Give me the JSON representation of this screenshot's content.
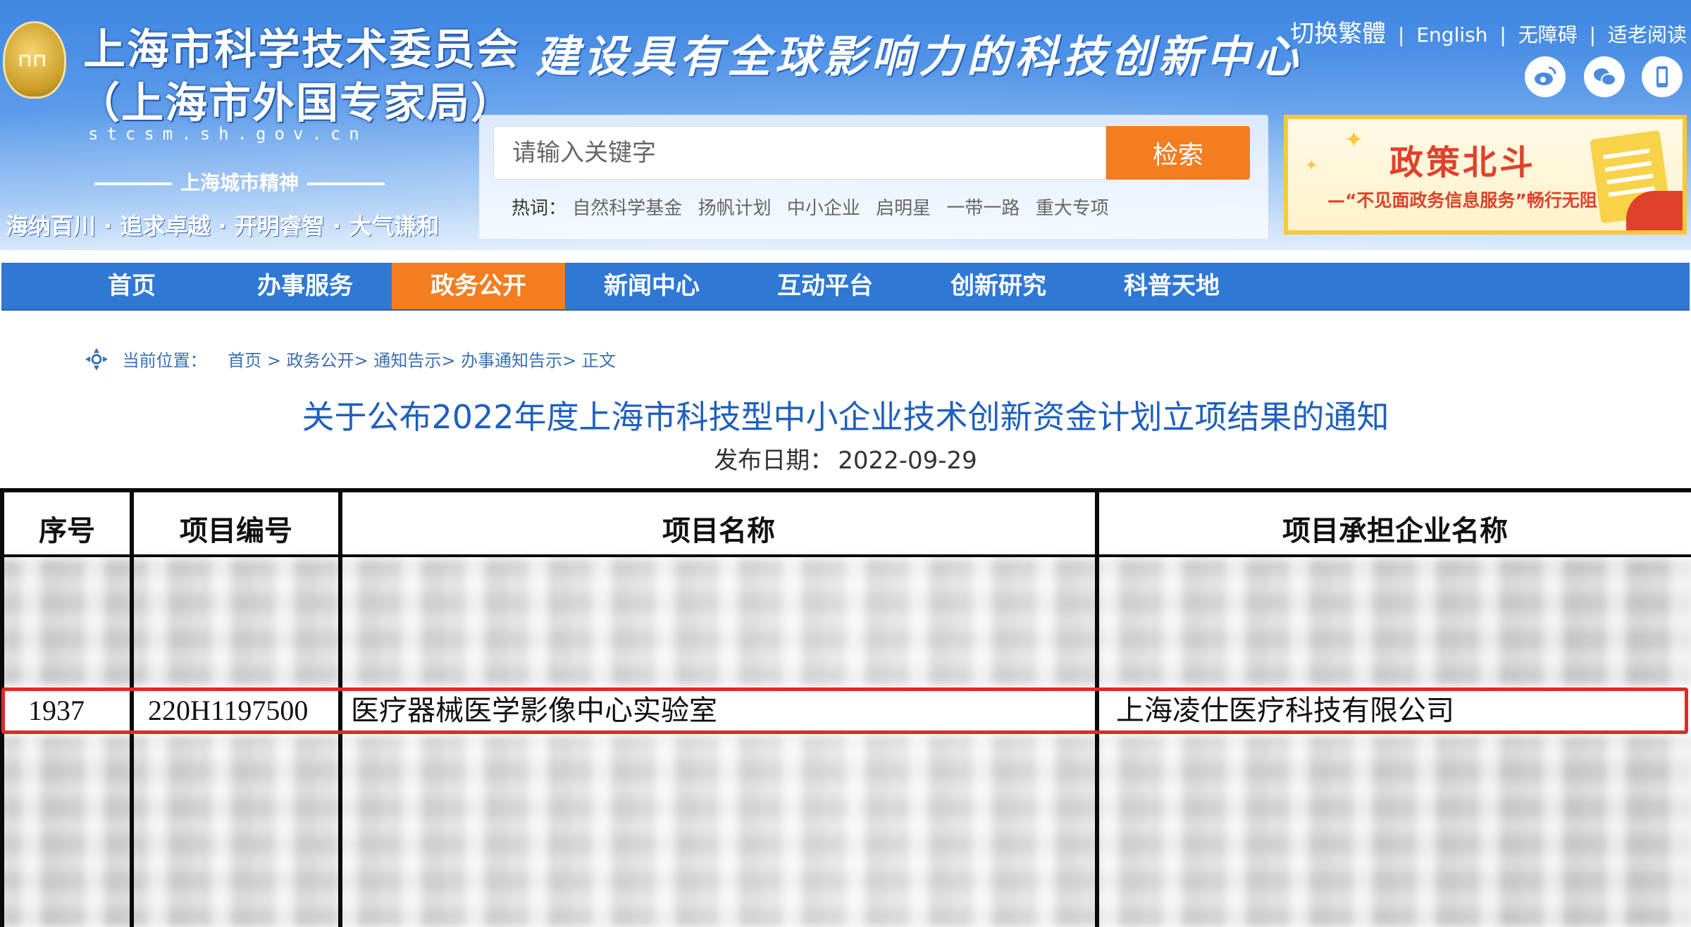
{
  "header": {
    "org_name": "上海市科学技术委员会",
    "org_sub": "（上海市外国专家局）",
    "domain": "stcsm.sh.gov.cn",
    "spirit_title": "上海城市精神",
    "spirit_motto": "海纳百川 · 追求卓越 · 开明睿智 · 大气谦和",
    "slogan": "建设具有全球影响力的科技创新中心",
    "top_links": [
      "切换繁體",
      "English",
      "无障碍",
      "适老阅读"
    ],
    "social_icons": [
      "weibo-icon",
      "wechat-icon",
      "mobile-icon"
    ]
  },
  "search": {
    "placeholder": "请输入关键字",
    "button": "检索",
    "hot_label": "热词：",
    "hot_words": [
      "自然科学基金",
      "扬帆计划",
      "中小企业",
      "启明星",
      "一带一路",
      "重大专项"
    ]
  },
  "banner": {
    "title": "政策北斗",
    "subtitle": "—“不见面政务信息服务”畅行无阻"
  },
  "nav": {
    "items": [
      "首页",
      "办事服务",
      "政务公开",
      "新闻中心",
      "互动平台",
      "创新研究",
      "科普天地"
    ],
    "active_index": 2
  },
  "breadcrumb": {
    "label": "当前位置：",
    "items": [
      "首页 >",
      "政务公开>",
      "通知告示>",
      "办事通知告示>",
      "正文"
    ]
  },
  "article": {
    "title": "关于公布2022年度上海市科技型中小企业技术创新资金计划立项结果的通知",
    "date_label": "发布日期：",
    "date": "2022-09-29"
  },
  "table": {
    "headers": [
      "序号",
      "项目编号",
      "项目名称",
      "项目承担企业名称"
    ],
    "highlighted_row": [
      "1937",
      "220H1197500",
      "医疗器械医学影像中心实验室",
      "上海凌仕医疗科技有限公司"
    ]
  },
  "colors": {
    "nav_blue": "#2f78d4",
    "accent_orange": "#f47d1f",
    "title_blue": "#1f5fbf",
    "highlight_red": "#e02a2a"
  }
}
